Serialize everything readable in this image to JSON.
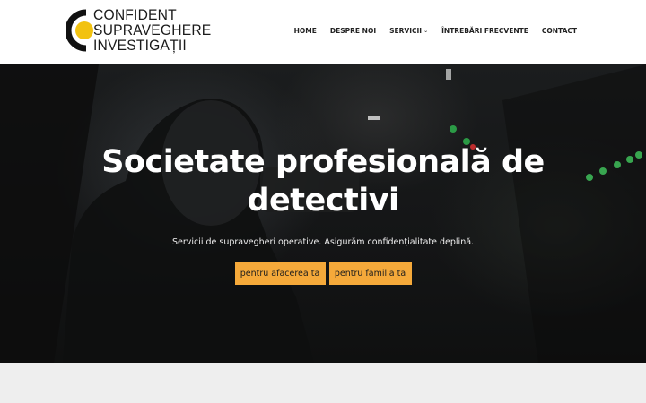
{
  "logo": {
    "lines": [
      "CONFIDENT",
      "SUPRAVEGHERE",
      "INVESTIGAȚII"
    ]
  },
  "nav": {
    "items": [
      {
        "label": "HOME"
      },
      {
        "label": "DESPRE NOI"
      },
      {
        "label": "SERVICII",
        "has_dropdown": true
      },
      {
        "label": "ÎNTREBĂRI FRECVENTE"
      },
      {
        "label": "CONTACT"
      }
    ]
  },
  "hero": {
    "title_line1": "Societate profesională de",
    "title_line2": "detectivi",
    "subtitle": "Servicii de supravegheri operative. Asigurăm confidențialitate deplină.",
    "buttons": [
      {
        "label": "pentru afacerea ta"
      },
      {
        "label": "pentru familia ta"
      }
    ]
  },
  "colors": {
    "accent": "#f5a93a",
    "logo_yellow": "#f2c20f",
    "hero_text": "#ffffff",
    "bottom_band": "#eeeeee"
  },
  "icons": {
    "dropdown": "chevron-down-icon",
    "logo": "logo-c-mark-icon"
  }
}
